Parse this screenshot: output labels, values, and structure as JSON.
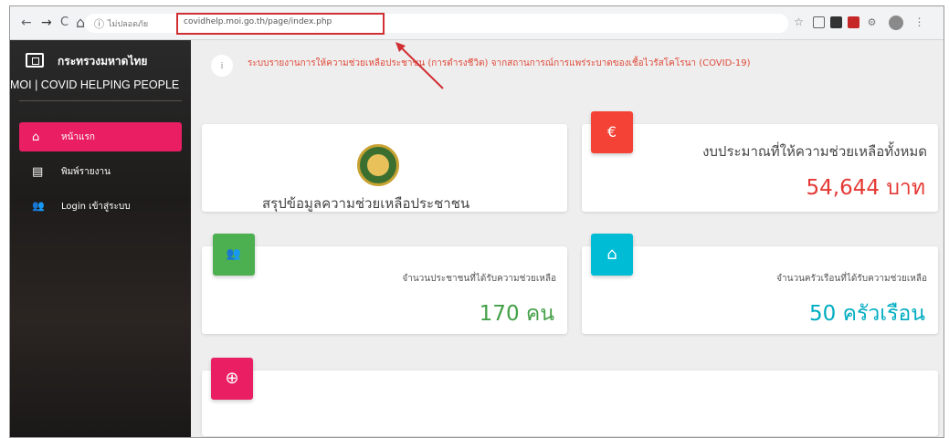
{
  "browser": {
    "nav_back": "←",
    "nav_forward": "→",
    "nav_reload": "C",
    "nav_home": "⌂",
    "info_glyph": "ⓘ",
    "security_text": "ไม่ปลอดภัย",
    "url": "covidhelp.moi.go.th/page/index.php"
  },
  "sidebar": {
    "brand_th": "กระทรวงมหาดไทย",
    "brand_en": "MOI | COVID HELPING PEOPLE",
    "items": [
      {
        "icon": "⌂",
        "label": "หน้าแรก"
      },
      {
        "icon": "▤",
        "label": "พิมพ์รายงาน"
      },
      {
        "icon": "👥",
        "label": "Login เข้าสู่ระบบ"
      }
    ]
  },
  "main": {
    "notice_icon": "i",
    "notice": "ระบบรายงานการให้ความช่วยเหลือประชาชน (การดำรงชีวิต) จากสถานการณ์การแพร่ระบาดของเชื้อไวรัสโคโรนา (COVID-19)",
    "summary_label": "สรุปข้อมูลความช่วยเหลือประชาชน",
    "budget": {
      "icon": "€",
      "label": "งบประมาณที่ให้ความช่วยเหลือทั้งหมด",
      "value": "54,644 บาท"
    },
    "people": {
      "icon": "👥",
      "label": "จำนวนประชาชนที่ได้รับความช่วยเหลือ",
      "value": "170 คน"
    },
    "households": {
      "icon": "⌂",
      "label": "จำนวนครัวเรือนที่ได้รับความช่วยเหลือ",
      "value": "50 ครัวเรือน"
    },
    "globe": {
      "icon": "⊕"
    }
  },
  "colors": {
    "accent": "#e91e63",
    "budget": "#f44336",
    "people": "#4caf50",
    "households": "#00bcd4",
    "budget_value": "#e53935",
    "people_value": "#43a047",
    "households_value": "#00acc1",
    "annotation": "#d03034"
  }
}
